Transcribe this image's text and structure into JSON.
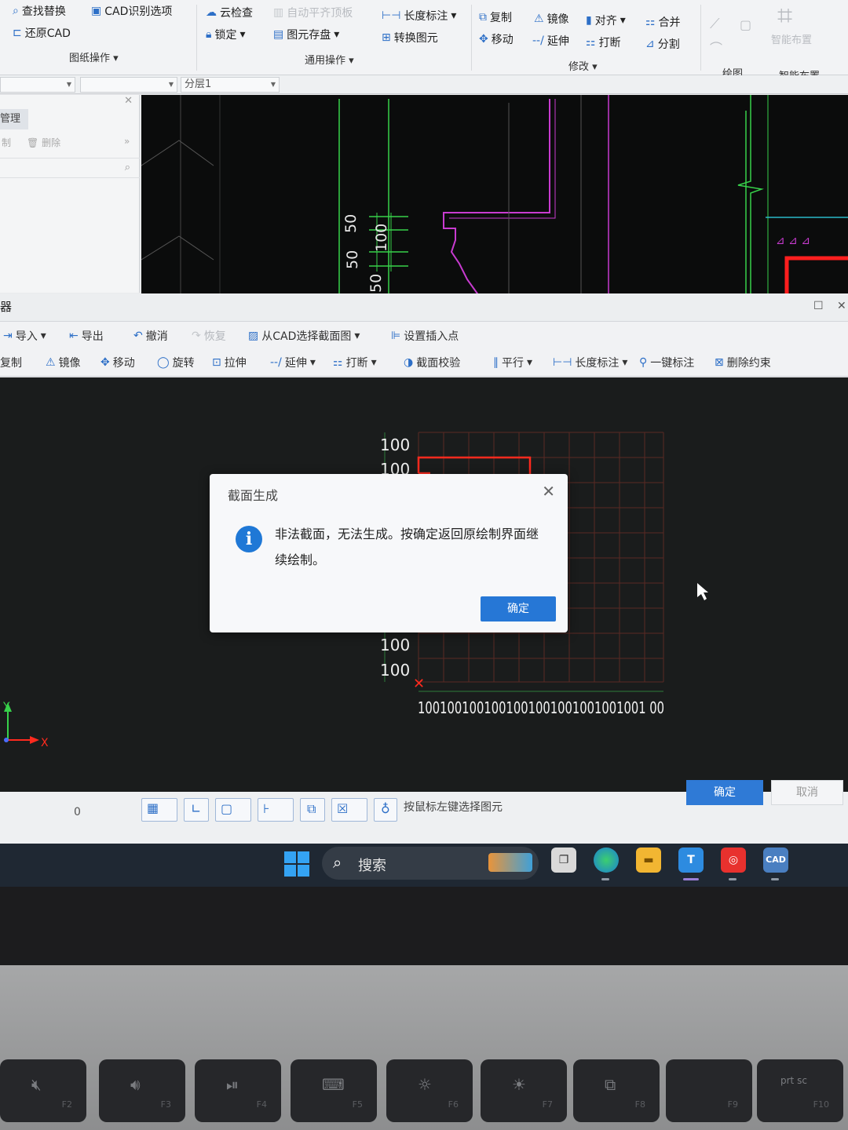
{
  "ribbon": {
    "items": [
      {
        "label": "查找替换",
        "icon": "search-replace-icon",
        "dim": false
      },
      {
        "label": "CAD识别选项",
        "icon": "cad-icon",
        "dim": false
      },
      {
        "label": "还原CAD",
        "icon": "restore-cad-icon",
        "dim": false
      },
      {
        "label": "云检查",
        "icon": "cloud-check-icon",
        "dim": false
      },
      {
        "label": "自动平齐顶板",
        "icon": "align-icon",
        "dim": true
      },
      {
        "label": "锁定",
        "icon": "lock-icon",
        "dim": false
      },
      {
        "label": "图元存盘",
        "icon": "save-element-icon",
        "dim": false
      },
      {
        "label": "长度标注",
        "icon": "dimension-icon",
        "dim": false
      },
      {
        "label": "转换图元",
        "icon": "convert-icon",
        "dim": false
      },
      {
        "label": "复制",
        "icon": "copy-icon",
        "dim": false
      },
      {
        "label": "镜像",
        "icon": "mirror-icon",
        "dim": false
      },
      {
        "label": "对齐",
        "icon": "align-icon",
        "dim": false
      },
      {
        "label": "合并",
        "icon": "merge-icon",
        "dim": false
      },
      {
        "label": "移动",
        "icon": "move-icon",
        "dim": false
      },
      {
        "label": "延伸",
        "icon": "extend-icon",
        "dim": false
      },
      {
        "label": "打断",
        "icon": "break-icon",
        "dim": false
      },
      {
        "label": "分割",
        "icon": "split-icon",
        "dim": false
      }
    ],
    "groups": {
      "drawing_ops": "图纸操作",
      "general_ops": "通用操作",
      "modify": "修改",
      "draw": "绘图",
      "smart_layout": "智能布置",
      "smart_layout_btn": "智能布置"
    }
  },
  "layerbar": {
    "layer": "分层1"
  },
  "leftpanel": {
    "tab": "管理",
    "tool_copy": "制",
    "tool_delete": "删除"
  },
  "top_canvas": {
    "dim_labels": [
      "50",
      "100",
      "50",
      "50"
    ]
  },
  "editor": {
    "title": "器",
    "toolbar1": [
      {
        "label": "导入",
        "icon": "import-icon"
      },
      {
        "label": "导出",
        "icon": "export-icon"
      },
      {
        "label": "撤消",
        "icon": "undo-icon"
      },
      {
        "label": "恢复",
        "icon": "redo-icon"
      },
      {
        "label": "从CAD选择截面图",
        "icon": "select-cad-section-icon"
      },
      {
        "label": "设置插入点",
        "icon": "insert-point-icon"
      }
    ],
    "toolbar2": [
      {
        "label": "复制",
        "icon": "copy-icon"
      },
      {
        "label": "镜像",
        "icon": "mirror-icon"
      },
      {
        "label": "移动",
        "icon": "move-icon"
      },
      {
        "label": "旋转",
        "icon": "rotate-icon"
      },
      {
        "label": "拉伸",
        "icon": "stretch-icon"
      },
      {
        "label": "延伸",
        "icon": "extend-icon"
      },
      {
        "label": "打断",
        "icon": "break-icon"
      },
      {
        "label": "截面校验",
        "icon": "section-check-icon"
      },
      {
        "label": "平行",
        "icon": "parallel-icon"
      },
      {
        "label": "长度标注",
        "icon": "dimension-icon"
      },
      {
        "label": "一键标注",
        "icon": "auto-dimension-icon"
      },
      {
        "label": "删除约束",
        "icon": "delete-constraint-icon"
      }
    ]
  },
  "grid": {
    "y_labels": [
      "100",
      "100",
      "100",
      "100"
    ],
    "x_label": "1001001001001001001001001001001 00",
    "axis_x": "X",
    "axis_y": "Y"
  },
  "dialog": {
    "title": "截面生成",
    "message": "非法截面，无法生成。按确定返回原绘制界面继续绘制。",
    "ok": "确定"
  },
  "statusbar": {
    "zero": "0",
    "hint": "按鼠标左键选择图元",
    "ok": "确定",
    "cancel": "取消"
  },
  "taskbar": {
    "search": "搜索"
  },
  "keyboard": {
    "fn_keys": [
      "F2",
      "F3",
      "F4",
      "F5",
      "F6",
      "F7",
      "F8",
      "F9",
      "F10"
    ],
    "prtsc": "prt sc"
  },
  "colors": {
    "accent": "#2f7ad6",
    "grid_red": "#e23b2c",
    "cad_green": "#37d14a",
    "cad_magenta": "#c83bd0"
  }
}
